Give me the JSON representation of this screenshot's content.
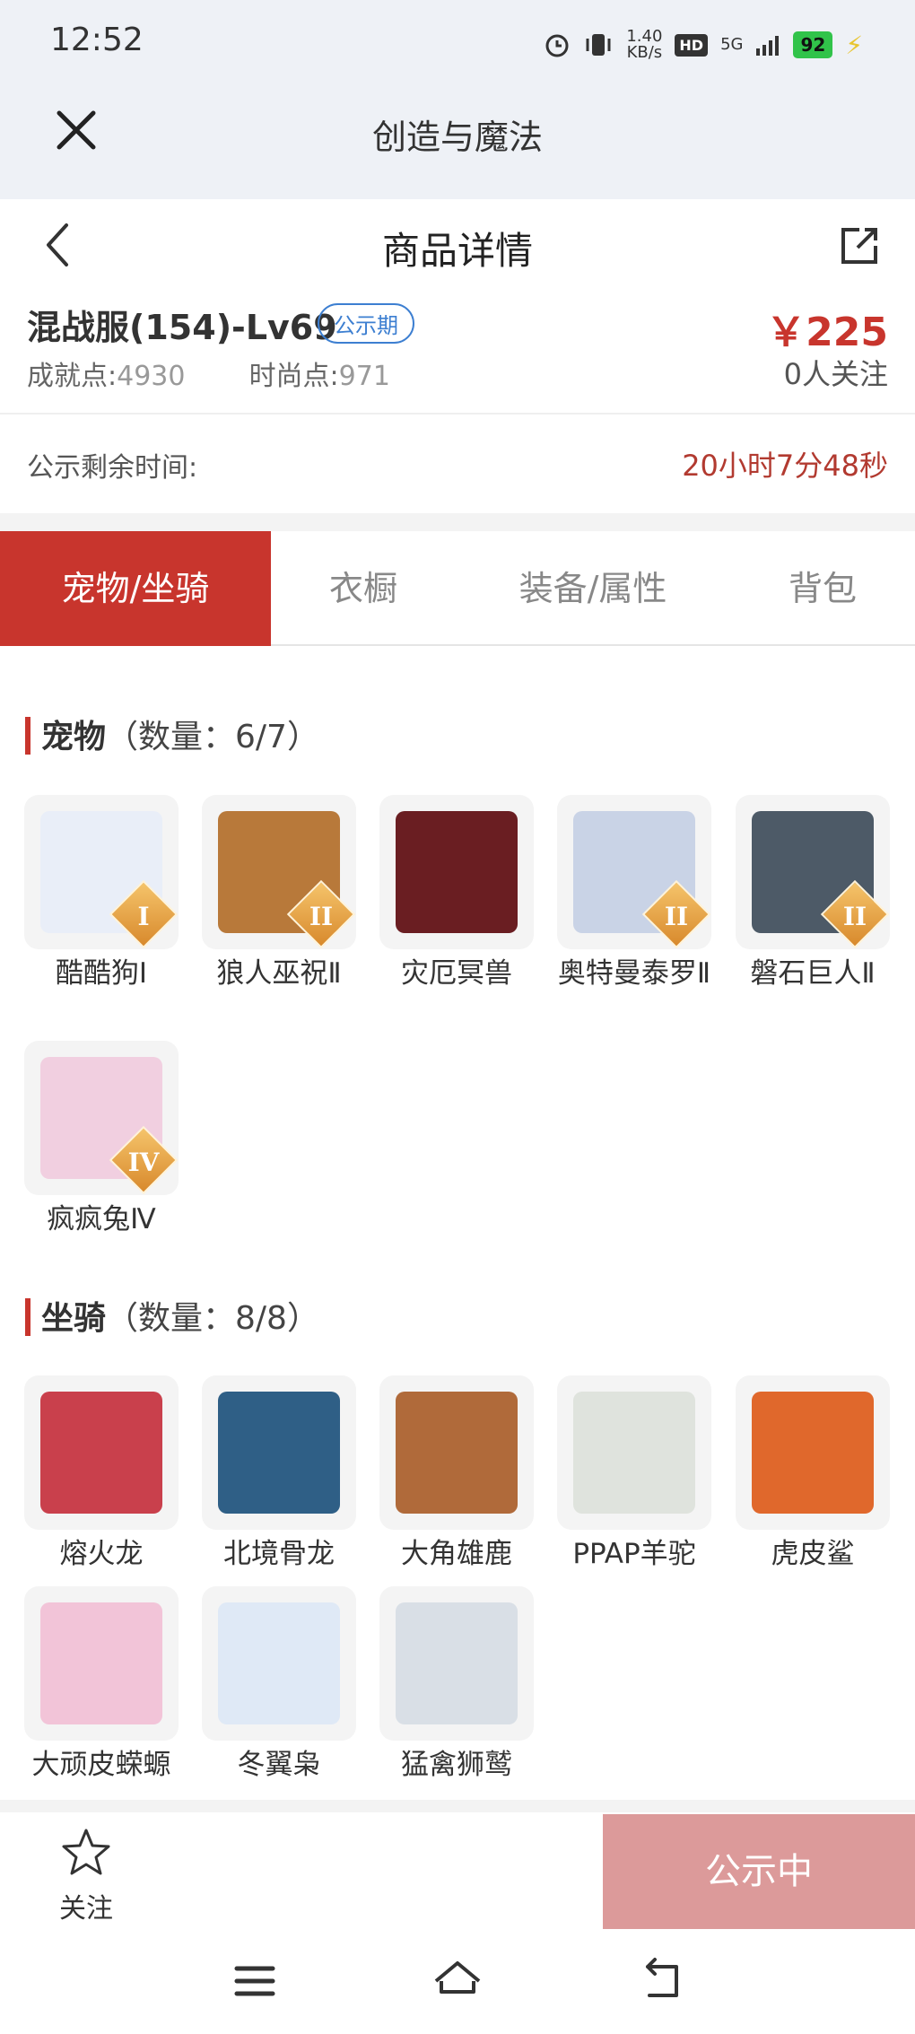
{
  "status_bar": {
    "time": "12:52",
    "net_speed_top": "1.40",
    "net_speed_bottom": "KB/s",
    "hd": "HD",
    "net_type": "5G",
    "battery": "92"
  },
  "app_bar": {
    "title": "创造与魔法"
  },
  "page_header": {
    "title": "商品详情"
  },
  "item": {
    "name": "混战服(154)-Lv69",
    "badge": "公示期",
    "price": "￥225",
    "achievement_label": "成就点:",
    "achievement_value": "4930",
    "fashion_label": "时尚点:",
    "fashion_value": "971",
    "followers": "0人关注"
  },
  "countdown": {
    "label": "公示剩余时间:",
    "value": "20小时7分48秒"
  },
  "tabs": [
    {
      "label": "宠物/坐骑",
      "active": true
    },
    {
      "label": "衣橱",
      "active": false
    },
    {
      "label": "装备/属性",
      "active": false
    },
    {
      "label": "背包",
      "active": false
    }
  ],
  "pets_section": {
    "title": "宠物",
    "count": "（数量：6/7）",
    "items": [
      {
        "name": "酷酷狗Ⅰ",
        "rank": "I",
        "color": "#e9eef8"
      },
      {
        "name": "狼人巫祝Ⅱ",
        "rank": "II",
        "color": "#b8793a"
      },
      {
        "name": "灾厄冥兽",
        "rank": "",
        "color": "#6a1e22"
      },
      {
        "name": "奥特曼泰罗Ⅱ",
        "rank": "II",
        "color": "#c9d3e6"
      },
      {
        "name": "磐石巨人Ⅱ",
        "rank": "II",
        "color": "#4d5a67"
      },
      {
        "name": "疯疯兔Ⅳ",
        "rank": "IV",
        "color": "#f1cfe0"
      }
    ]
  },
  "mounts_section": {
    "title": "坐骑",
    "count": "（数量：8/8）",
    "items": [
      {
        "name": "熔火龙",
        "color": "#c9404c"
      },
      {
        "name": "北境骨龙",
        "color": "#2f5f86"
      },
      {
        "name": "大角雄鹿",
        "color": "#b06a3a"
      },
      {
        "name": "PPAP羊驼",
        "color": "#dfe3dd"
      },
      {
        "name": "虎皮鲨",
        "color": "#e0682c"
      },
      {
        "name": "大顽皮蝾螈",
        "color": "#f2c4d8"
      },
      {
        "name": "冬翼枭",
        "color": "#dfe9f6"
      },
      {
        "name": "猛禽狮鹫",
        "color": "#d9dfe6"
      }
    ]
  },
  "bottom_bar": {
    "follow_label": "关注",
    "action_label": "公示中"
  }
}
